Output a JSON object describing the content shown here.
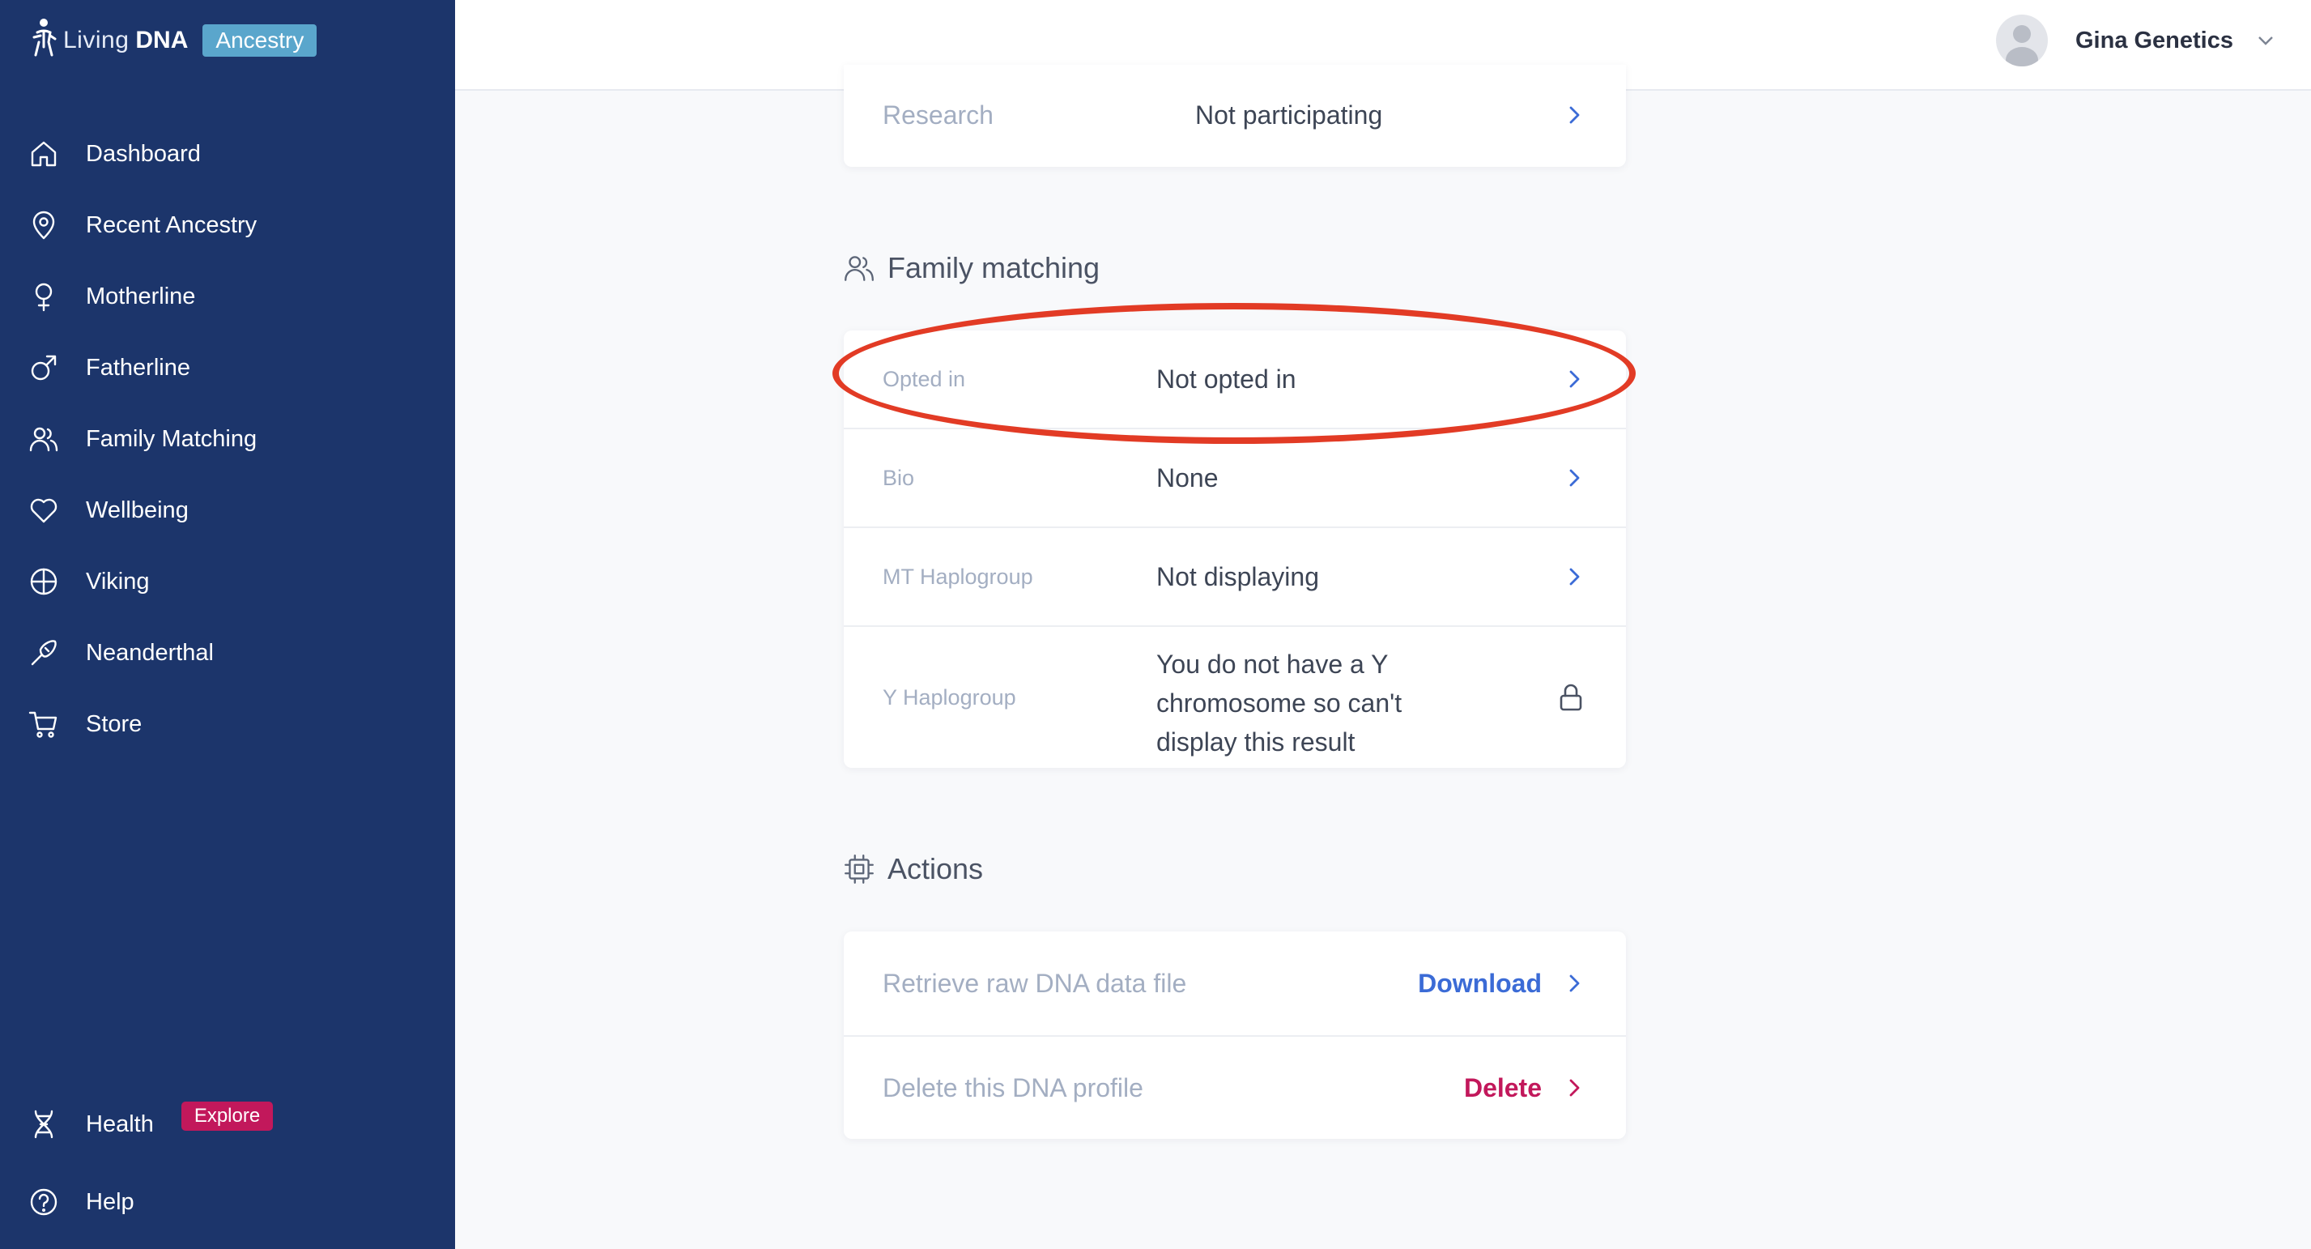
{
  "brand": {
    "living": "Living",
    "dna": "DNA",
    "tag": "Ancestry"
  },
  "sidebar": {
    "items": [
      {
        "label": "Dashboard",
        "icon": "home-icon"
      },
      {
        "label": "Recent Ancestry",
        "icon": "map-pin-icon"
      },
      {
        "label": "Motherline",
        "icon": "female-symbol-icon"
      },
      {
        "label": "Fatherline",
        "icon": "male-symbol-icon"
      },
      {
        "label": "Family Matching",
        "icon": "users-icon"
      },
      {
        "label": "Wellbeing",
        "icon": "heart-icon"
      },
      {
        "label": "Viking",
        "icon": "viking-shield-icon"
      },
      {
        "label": "Neanderthal",
        "icon": "club-icon"
      },
      {
        "label": "Store",
        "icon": "cart-icon"
      }
    ],
    "bottom": [
      {
        "label": "Health",
        "icon": "dna-helix-icon",
        "badge": "Explore"
      },
      {
        "label": "Help",
        "icon": "help-circle-icon"
      }
    ]
  },
  "header": {
    "user_name": "Gina Genetics"
  },
  "research": {
    "label": "Research",
    "value": "Not participating"
  },
  "family_matching": {
    "title": "Family matching",
    "rows": [
      {
        "label": "Opted in",
        "value": "Not opted in"
      },
      {
        "label": "Bio",
        "value": "None"
      },
      {
        "label": "MT Haplogroup",
        "value": "Not displaying"
      },
      {
        "label": "Y Haplogroup",
        "value_lines": [
          "You do not have a Y",
          "chromosome so can't",
          "display this result"
        ]
      }
    ]
  },
  "actions": {
    "title": "Actions",
    "rows": [
      {
        "label": "Retrieve raw DNA data file",
        "link": "Download"
      },
      {
        "label": "Delete this DNA profile",
        "link": "Delete"
      }
    ]
  },
  "colors": {
    "sidebar_bg": "#1c356b",
    "accent_blue": "#3b6bd6",
    "delete_red": "#c2185b",
    "badge_bg": "#5aa6cc",
    "highlight": "#e23b25"
  }
}
